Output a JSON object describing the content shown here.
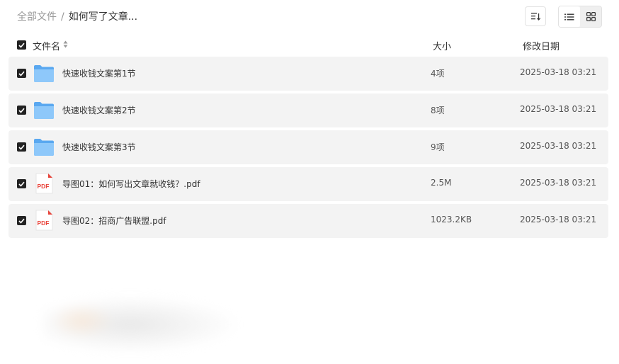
{
  "breadcrumb": {
    "root": "全部文件",
    "separator": "/",
    "current": "如何写了文章..."
  },
  "toolbar": {
    "sort_icon": "sort-icon",
    "list_view_icon": "list-view-icon",
    "grid_view_icon": "grid-view-icon"
  },
  "table": {
    "columns": {
      "name": "文件名",
      "size": "大小",
      "date": "修改日期"
    },
    "rows": [
      {
        "name": "快速收钱文案第1节",
        "size": "4项",
        "date": "2025-03-18 03:21",
        "type": "folder"
      },
      {
        "name": "快速收钱文案第2节",
        "size": "8项",
        "date": "2025-03-18 03:21",
        "type": "folder"
      },
      {
        "name": "快速收钱文案第3节",
        "size": "9项",
        "date": "2025-03-18 03:21",
        "type": "folder"
      },
      {
        "name": "导图01：如何写出文章就收钱？.pdf",
        "size": "2.5M",
        "date": "2025-03-18 03:21",
        "type": "pdf"
      },
      {
        "name": "导图02：招商广告联盟.pdf",
        "size": "1023.2KB",
        "date": "2025-03-18 03:21",
        "type": "pdf"
      }
    ]
  },
  "icons": {
    "pdf_badge": "PDF"
  },
  "colors": {
    "folder": "#6ab4f5",
    "pdf_red": "#e8453c",
    "row_bg": "#f3f3f3",
    "checkbox": "#222222"
  }
}
